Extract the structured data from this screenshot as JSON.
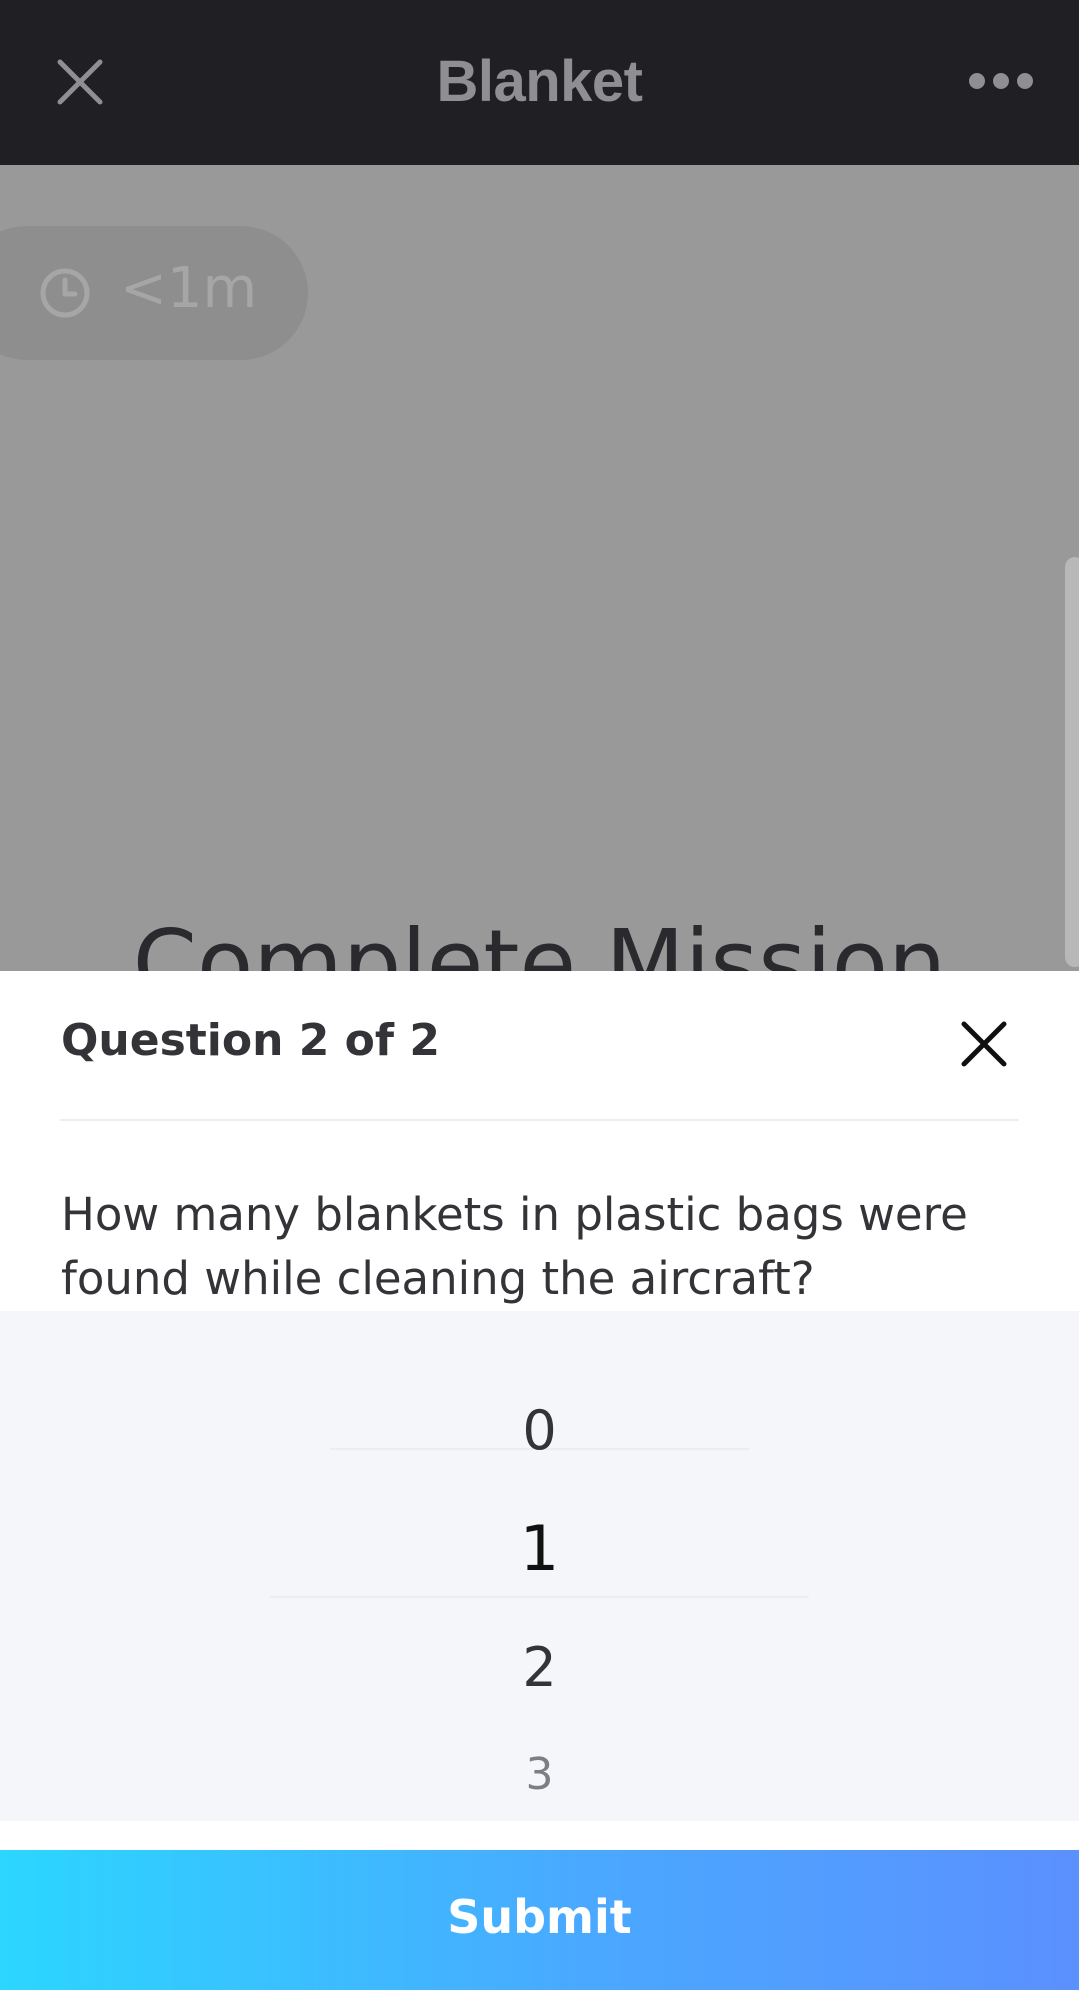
{
  "appbar": {
    "title": "Blanket",
    "close_icon": "close-icon",
    "more_icon": "more-horizontal-icon"
  },
  "background": {
    "duration": "<1m",
    "duration_icon": "clock-icon",
    "heading": "Complete Mission"
  },
  "sheet": {
    "title": "Question 2 of 2",
    "close_icon": "close-icon",
    "question": "How many blankets in plastic bags were found while cleaning the aircraft?",
    "picker": {
      "options": [
        "0",
        "1",
        "2",
        "3"
      ],
      "selected": "1"
    },
    "submit_label": "Submit"
  },
  "colors": {
    "appbar_bg": "#1f1f24",
    "overlay_bg": "#999999",
    "sheet_bg": "#ffffff",
    "picker_bg": "#f4f6fa",
    "submit_gradient_start": "#2bd6ff",
    "submit_gradient_end": "#5b90ff"
  }
}
